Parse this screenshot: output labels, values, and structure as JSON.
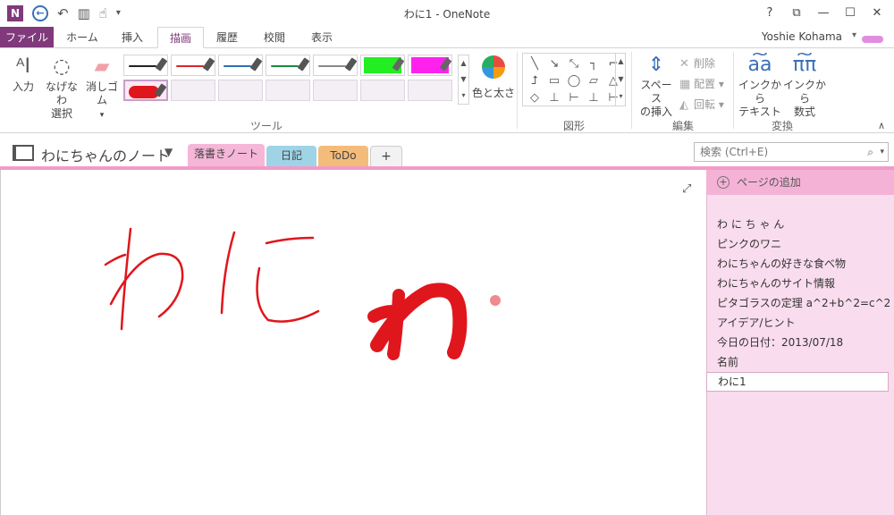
{
  "window": {
    "title": "わに1 - OneNote",
    "app_icon": "N"
  },
  "qat": {
    "icons": [
      "back-icon",
      "undo-icon",
      "dock-icon",
      "touch-mode-icon",
      "customize-icon"
    ]
  },
  "window_controls": {
    "help": "?",
    "fullscreen": "⧉",
    "minimize": "—",
    "maximize": "☐",
    "close": "✕"
  },
  "ribbon_tabs": {
    "file": "ファイル",
    "items": [
      "ホーム",
      "挿入",
      "描画",
      "履歴",
      "校閲",
      "表示"
    ],
    "active": "描画"
  },
  "user": {
    "name": "Yoshie Kohama"
  },
  "ribbon": {
    "input": "入力",
    "lasso": [
      "なげなわ",
      "選択"
    ],
    "eraser": "消しゴム",
    "color_thickness": "色と太さ",
    "tools_group": "ツール",
    "shapes_group": "図形",
    "insert_space": [
      "スペース",
      "の挿入"
    ],
    "delete": "削除",
    "arrange": "配置",
    "rotate": "回転",
    "edit_group": "編集",
    "ink_to_text": [
      "インクから",
      "テキスト"
    ],
    "ink_to_math": [
      "インクから",
      "数式"
    ],
    "convert_group": "変換",
    "pens": [
      {
        "kind": "pen",
        "color": "#222222"
      },
      {
        "kind": "pen",
        "color": "#d9262c"
      },
      {
        "kind": "pen",
        "color": "#2e6db4"
      },
      {
        "kind": "pen",
        "color": "#1a8a3a"
      },
      {
        "kind": "pen",
        "color": "#888888"
      },
      {
        "kind": "highlighter",
        "color": "#22ee22"
      },
      {
        "kind": "highlighter",
        "color": "#ff22ee"
      },
      {
        "kind": "marker",
        "color": "#e0161d",
        "selected": true
      },
      {
        "kind": "empty"
      },
      {
        "kind": "empty"
      },
      {
        "kind": "empty"
      },
      {
        "kind": "empty"
      },
      {
        "kind": "empty"
      },
      {
        "kind": "empty"
      }
    ],
    "shapes": [
      "╲",
      "↘",
      "⤡",
      "┐",
      "⌐",
      "⮥",
      "▭",
      "◯",
      "▱",
      "△",
      "◇",
      "⊥",
      "⊢",
      "⊥",
      "⊢"
    ]
  },
  "notebook": {
    "name": "わにちゃんのノート",
    "sections": [
      {
        "label": "落書きノート",
        "color": "#f5b6d7",
        "active": true
      },
      {
        "label": "日記",
        "color": "#9fd3e6"
      },
      {
        "label": "ToDo",
        "color": "#f4bc7a"
      },
      {
        "label": "+",
        "color": "#f2f2f2"
      }
    ]
  },
  "search": {
    "placeholder": "検索 (Ctrl+E)"
  },
  "pages": {
    "add": "ページの追加",
    "items": [
      "わ に ち ゃ ん",
      "ピンクのワニ",
      "わにちゃんの好きな食べ物",
      "わにちゃんのサイト情報",
      "ピタゴラスの定理  a^2+b^2=c^2",
      "アイデア/ヒント",
      "今日の日付：2013/07/18",
      "名前",
      "わに1"
    ],
    "current": "わに1"
  },
  "colors": {
    "accent": "#80397b",
    "section_bar": "#f29bc8",
    "page_panel": "#f9dced",
    "ink_red": "#e0161d"
  }
}
